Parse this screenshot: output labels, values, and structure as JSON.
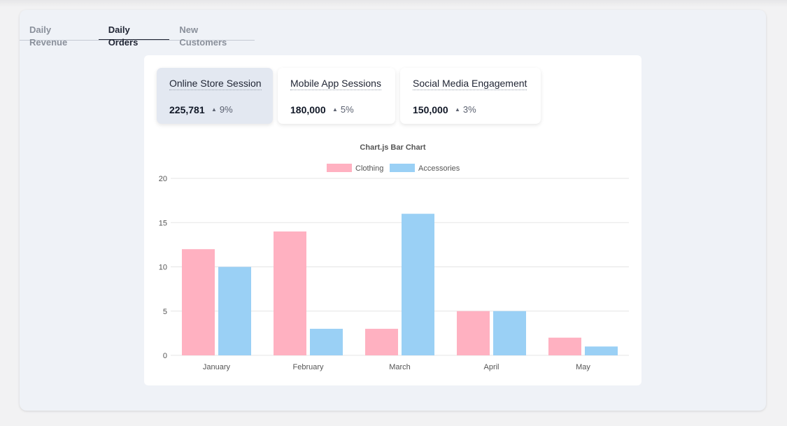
{
  "tabs": [
    {
      "label": "Daily Revenue"
    },
    {
      "label": "Daily Orders"
    },
    {
      "label": "New Customers"
    }
  ],
  "kpis": [
    {
      "title": "Online Store Session",
      "value": "225,781",
      "delta": "9%"
    },
    {
      "title": "Mobile App Sessions",
      "value": "180,000",
      "delta": "5%"
    },
    {
      "title": "Social Media Engagement",
      "value": "150,000",
      "delta": "3%"
    }
  ],
  "colors": {
    "clothing": "#ffb1c1",
    "accessories": "#9ad0f5"
  },
  "chart_data": {
    "type": "bar",
    "title": "Chart.js Bar Chart",
    "categories": [
      "January",
      "February",
      "March",
      "April",
      "May"
    ],
    "series": [
      {
        "name": "Clothing",
        "values": [
          12,
          14,
          3,
          5,
          2
        ]
      },
      {
        "name": "Accessories",
        "values": [
          10,
          3,
          16,
          5,
          1
        ]
      }
    ],
    "yticks": [
      0,
      5,
      10,
      15,
      20
    ],
    "ylim": [
      0,
      20
    ],
    "grid": true,
    "legend": "top"
  }
}
